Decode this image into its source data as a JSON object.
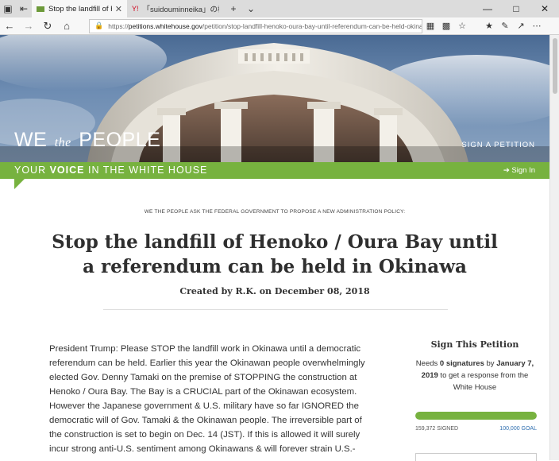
{
  "browser": {
    "tabs": [
      {
        "title": "Stop the landfill of Henoko",
        "active": true
      },
      {
        "title": "「suidouminneika」の検索結果",
        "active": false
      }
    ],
    "url_prefix": "https://",
    "url_host": "petitions.whitehouse.gov",
    "url_path": "/petition/stop-landfill-henoko-oura-bay-until-referendum-can-be-held-okinawa"
  },
  "header": {
    "brand_we": "WE",
    "brand_the": "the",
    "brand_people": "PEOPLE",
    "sign_petition": "SIGN A PETITION",
    "tagline_pre": "YOUR ",
    "tagline_bold": "VOICE",
    "tagline_post": " IN THE WHITE HOUSE",
    "sign_in": "Sign In"
  },
  "petition": {
    "ask": "WE THE PEOPLE ASK THE FEDERAL GOVERNMENT TO PROPOSE A NEW ADMINISTRATION POLICY:",
    "title": "Stop the landfill of Henoko / Oura Bay until a referendum can be held in Okinawa",
    "created_by": "Created by R.K. on December 08, 2018",
    "body": "President Trump: Please STOP the landfill work in Okinawa until a democratic referendum can be held. Earlier this year the Okinawan people overwhelmingly elected Gov. Denny Tamaki on the premise of STOPPING the construction at Henoko / Oura Bay. The Bay is a CRUCIAL part of the Okinawan ecosystem. However the Japanese government & U.S. military have so far IGNORED the democratic will of Gov. Tamaki & the Okinawan people. The irreversible part of the construction is set to begin on Dec. 14 (JST). If this is allowed it will surely incur strong anti-U.S. sentiment among Okinawans & will forever strain U.S.-"
  },
  "sidebar": {
    "heading": "Sign This Petition",
    "needs_pre": "Needs ",
    "needs_count": "0 signatures",
    "needs_by": " by ",
    "needs_date": "January 7, 2019",
    "needs_post": " to get a response from the White House",
    "progress_fraction": 1.0,
    "signed": "159,372 SIGNED",
    "goal": "100,000 GOAL"
  },
  "colors": {
    "accent_green": "#77b23f",
    "link_blue": "#2f6fb0"
  }
}
